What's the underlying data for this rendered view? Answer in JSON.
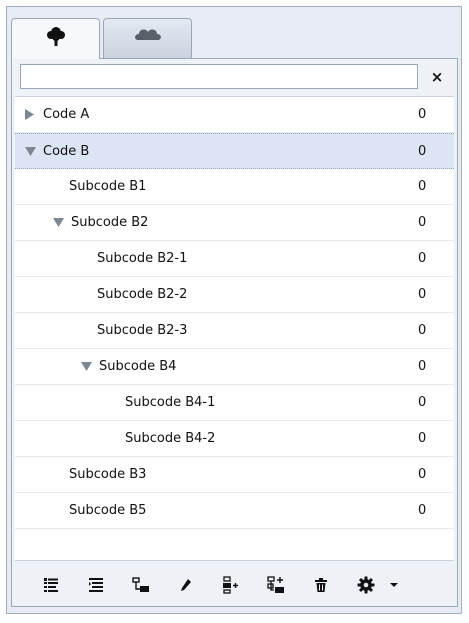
{
  "tabs": [
    {
      "icon": "tree-icon",
      "active": true
    },
    {
      "icon": "cloud-icon",
      "active": false
    }
  ],
  "search": {
    "value": "",
    "placeholder": "",
    "clear_label": "×"
  },
  "codes": [
    {
      "label": "Code A",
      "count": "0",
      "level": 0,
      "caret": "collapsed",
      "selected": false
    },
    {
      "label": "Code B",
      "count": "0",
      "level": 0,
      "caret": "expanded",
      "selected": true
    },
    {
      "label": "Subcode B1",
      "count": "0",
      "level": 1,
      "caret": "none",
      "selected": false
    },
    {
      "label": "Subcode B2",
      "count": "0",
      "level": 1,
      "caret": "expanded",
      "selected": false
    },
    {
      "label": "Subcode B2-1",
      "count": "0",
      "level": 2,
      "caret": "none",
      "selected": false
    },
    {
      "label": "Subcode B2-2",
      "count": "0",
      "level": 2,
      "caret": "none",
      "selected": false
    },
    {
      "label": "Subcode B2-3",
      "count": "0",
      "level": 2,
      "caret": "none",
      "selected": false
    },
    {
      "label": "Subcode B4",
      "count": "0",
      "level": 2,
      "caret": "expanded",
      "selected": false
    },
    {
      "label": "Subcode B4-1",
      "count": "0",
      "level": 3,
      "caret": "none",
      "selected": false
    },
    {
      "label": "Subcode B4-2",
      "count": "0",
      "level": 3,
      "caret": "none",
      "selected": false
    },
    {
      "label": "Subcode B3",
      "count": "0",
      "level": 1,
      "caret": "none",
      "selected": false
    },
    {
      "label": "Subcode B5",
      "count": "0",
      "level": 1,
      "caret": "none",
      "selected": false
    }
  ],
  "toolbar": [
    {
      "name": "align-left-icon"
    },
    {
      "name": "indent-icon"
    },
    {
      "name": "hierarchy-icon"
    },
    {
      "name": "pencil-icon"
    },
    {
      "name": "add-child-icon"
    },
    {
      "name": "add-sibling-icon"
    },
    {
      "name": "trash-icon"
    },
    {
      "name": "gear-icon"
    },
    {
      "name": "dropdown-arrow-icon"
    }
  ],
  "colors": {
    "selection": "#dbe5f3",
    "caret": "#7d8794",
    "panel": "#e7ecf4"
  }
}
